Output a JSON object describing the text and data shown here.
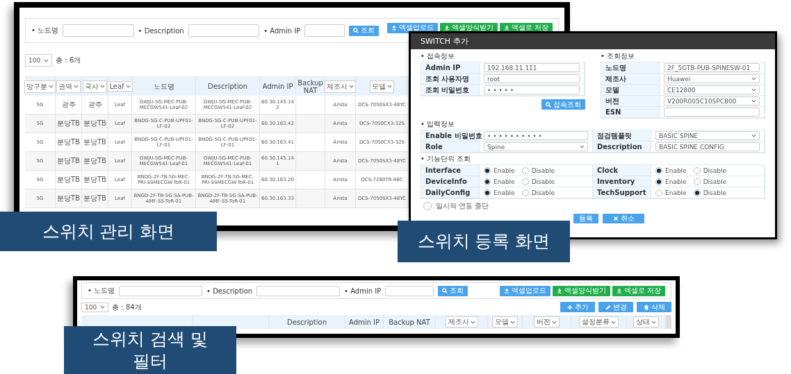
{
  "management_screen": {
    "search": {
      "fields": [
        {
          "label": "• 노드명"
        },
        {
          "label": "• Description"
        },
        {
          "label": "• Admin IP"
        }
      ],
      "button": "조회",
      "excel_buttons": [
        {
          "label": "엑셀업로드",
          "kind": "upload"
        },
        {
          "label": "엑셀양식받기",
          "kind": "download"
        },
        {
          "label": "엑셀로 저장",
          "kind": "download"
        }
      ]
    },
    "page_size": "100",
    "total": "총 : 6개",
    "table": {
      "columns": [
        {
          "label": "망구분",
          "kind": "filter"
        },
        {
          "label": "권역",
          "kind": "filter"
        },
        {
          "label": "국사",
          "kind": "filter"
        },
        {
          "label": "Leaf",
          "kind": "filter"
        },
        {
          "label": "노드명",
          "kind": "plain"
        },
        {
          "label": "Description",
          "kind": "plain"
        },
        {
          "label": "Admin IP",
          "kind": "plain"
        },
        {
          "label": "Backup NAT",
          "kind": "plain"
        },
        {
          "label": "제조사",
          "kind": "filter"
        },
        {
          "label": "모델",
          "kind": "filter"
        }
      ],
      "rows": [
        {
          "network": "5G",
          "region": "광주",
          "office": "광주",
          "role": "Leaf",
          "node_name": "GWJU-5G-MEC-PUB-MECGW541-Leaf-02",
          "description": "GWJU-5G-MEC-PUB-MECGW541-Leaf-02",
          "admin_ip": "60.30.145.142",
          "vendor": "Arista",
          "model": "DCS-7050SX3-48YC"
        },
        {
          "network": "5G",
          "region": "분당TB",
          "office": "분당TB",
          "role": "Leaf",
          "node_name": "BNDG-5G-C-PUB-UPF01-LF-02",
          "description": "BNDG-5G-C-PUB-UPF01-LF-02",
          "admin_ip": "60.30.163.42",
          "vendor": "Arista",
          "model": "DCS-7050CX3-32S"
        },
        {
          "network": "5G",
          "region": "분당TB",
          "office": "분당TB",
          "role": "Leaf",
          "node_name": "BNDG-5G-C-PUB-UPF01-LF-01",
          "description": "BNDG-5G-C-PUB-UPF01-LF-01",
          "admin_ip": "60.30.163.41",
          "vendor": "Arista",
          "model": "DCS-7050CX3-32S"
        },
        {
          "network": "5G",
          "region": "분당TB",
          "office": "분당TB",
          "role": "Leaf",
          "node_name": "GWJU-5G-MEC-PUB-MECGW541-Leaf-01",
          "description": "GWJU-5G-MEC-PUB-MECGW541-Leaf-01",
          "admin_ip": "60.30.145.141",
          "vendor": "Arista",
          "model": "DCS-7050SX3-48YC"
        },
        {
          "network": "5G",
          "region": "분당TB",
          "office": "분당TB",
          "role": "Leaf",
          "node_name": "BNDG-2F-TB-5G-MEC-PRI-SSMECGW-ToR-01",
          "description": "BNDG-2F-TB-5G-MEC-PRI-SSMECGW-ToR-01",
          "admin_ip": "60.30.163.20",
          "vendor": "Arista",
          "model": "DCS-7280TR-48C"
        },
        {
          "network": "5G",
          "region": "분당TB",
          "office": "분당TB",
          "role": "Leaf",
          "node_name": "BNGD-2F-TB-5G-SA-PUB-AMF-SS-ToR-01",
          "description": "BNGD-2F-TB-5G-SA-PUB-AMF-SS-ToR-01",
          "admin_ip": "60.30.163.33",
          "vendor": "Arista",
          "model": "DCS-7050SX3-48YC"
        }
      ]
    },
    "caption": "스위치 관리 화면"
  },
  "register_dialog": {
    "title": "SWITCH 추가",
    "connection": {
      "heading": "• 접속정보",
      "rows": [
        {
          "label": "Admin IP",
          "value": "192.168.11.111",
          "kind": "text"
        },
        {
          "label": "조회 사용자명",
          "value": "root",
          "kind": "text"
        },
        {
          "label": "조회 비밀번호",
          "value": "• • • • •",
          "kind": "text"
        }
      ],
      "button": "접속조회"
    },
    "lookup": {
      "heading": "• 조회정보",
      "rows": [
        {
          "label": "노드명",
          "value": "2F_5GTB-PUB-SPINESW-01",
          "kind": "text"
        },
        {
          "label": "제조사",
          "value": "Huawei",
          "kind": "select"
        },
        {
          "label": "모델",
          "value": "CE12800",
          "kind": "select"
        },
        {
          "label": "버전",
          "value": "V200R005C10SPC800",
          "kind": "select"
        },
        {
          "label": "ESN",
          "kind": "text"
        }
      ]
    },
    "input": {
      "heading": "• 입력정보",
      "rows": [
        {
          "label": "Enable 비밀번호",
          "value": "• • • • • • • • • •",
          "kind": "text"
        },
        {
          "label": "점검템플릿",
          "value": "BASIC SPINE",
          "kind": "select"
        },
        {
          "label": "Role",
          "value": "Spine",
          "kind": "select"
        },
        {
          "label": "Description",
          "value": "BASIC SPINE CONFIG",
          "kind": "text"
        }
      ]
    },
    "functions": {
      "heading": "• 기능단위 조회",
      "items": [
        {
          "label": "Interface",
          "options": [
            {
              "label": "Enable",
              "selected": true
            },
            {
              "label": "Disable",
              "selected": false
            }
          ]
        },
        {
          "label": "Clock",
          "options": [
            {
              "label": "Enable",
              "selected": true
            },
            {
              "label": "Disable",
              "selected": false
            }
          ]
        },
        {
          "label": "DeviceInfo",
          "options": [
            {
              "label": "Enable",
              "selected": true
            },
            {
              "label": "Disable",
              "selected": false
            }
          ]
        },
        {
          "label": "Inventory",
          "options": [
            {
              "label": "Enable",
              "selected": true
            },
            {
              "label": "Disable",
              "selected": false
            }
          ]
        },
        {
          "label": "DailyConfig",
          "options": [
            {
              "label": "Enable",
              "selected": true
            },
            {
              "label": "Disable",
              "selected": false
            }
          ]
        },
        {
          "label": "TechSupport",
          "options": [
            {
              "label": "Enable",
              "selected": false
            },
            {
              "label": "Disable",
              "selected": true
            }
          ]
        }
      ]
    },
    "suspend": {
      "label": "일시적 연동 중단",
      "checked": false
    },
    "buttons": [
      {
        "label": "등록",
        "kind": "register"
      },
      {
        "label": "취소",
        "kind": "cancel"
      }
    ],
    "caption": "스위치 등록 화면"
  },
  "search_filter_screen": {
    "search": {
      "fields": [
        {
          "label": "• 노드명"
        },
        {
          "label": "• Description"
        },
        {
          "label": "• Admin IP"
        }
      ],
      "button": "조회",
      "excel_buttons": [
        {
          "label": "엑셀업로드",
          "kind": "upload"
        },
        {
          "label": "엑셀양식받기",
          "kind": "download"
        },
        {
          "label": "엑셀로 저장",
          "kind": "download"
        }
      ]
    },
    "page_size": "100",
    "total": "총 : 84개",
    "action_buttons": [
      {
        "label": "추가",
        "kind": "add"
      },
      {
        "label": "변경",
        "kind": "edit"
      },
      {
        "label": "삭제",
        "kind": "delete"
      }
    ],
    "table": {
      "columns": [
        {
          "label": "Description",
          "kind": "plain"
        },
        {
          "label": "Admin IP",
          "kind": "plain"
        },
        {
          "label": "Backup NAT",
          "kind": "plain"
        },
        {
          "label": "제조사",
          "kind": "filter"
        },
        {
          "label": "모델",
          "kind": "filter"
        },
        {
          "label": "버전",
          "kind": "filter"
        },
        {
          "label": "설정분류",
          "kind": "filter"
        },
        {
          "label": "상태",
          "kind": "filter"
        }
      ]
    },
    "caption": "스위치 검색 및 필터"
  }
}
